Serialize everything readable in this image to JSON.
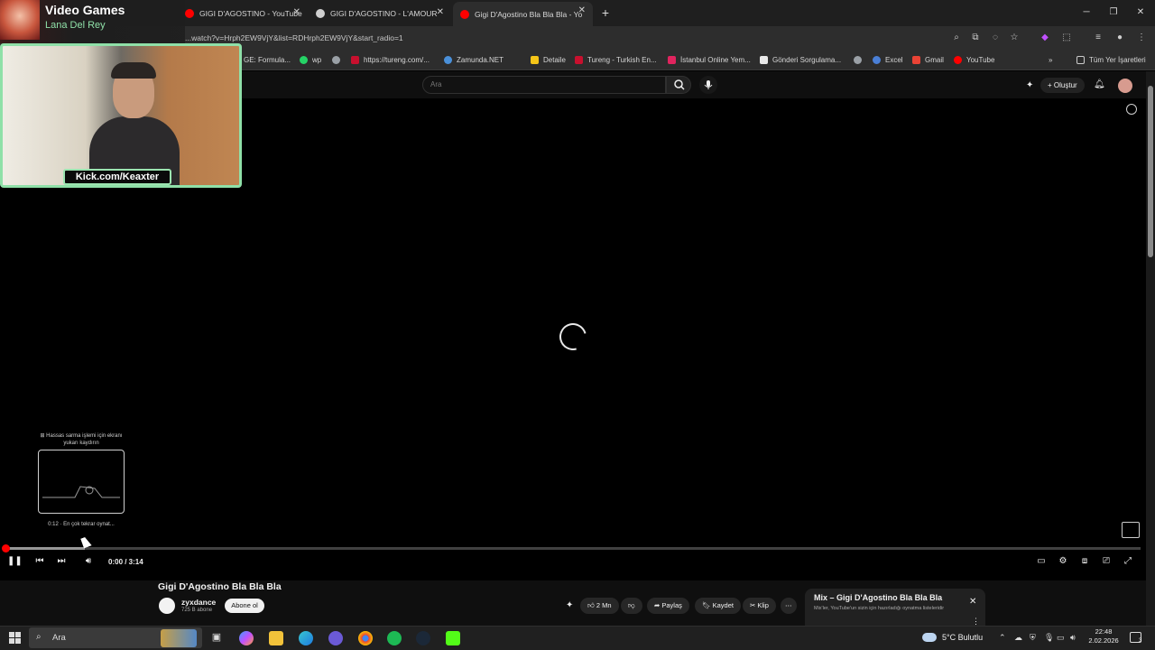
{
  "browser": {
    "tabs": [
      {
        "label": "GIGI D'AGOSTINO - YouTube",
        "color": "#ff0000"
      },
      {
        "label": "GIGI D'AGOSTINO - L'AMOUR",
        "color": "#cfcfcf"
      },
      {
        "label": "Gigi D'Agostino Bla Bla Bla - Yo",
        "color": "#ff0000"
      }
    ],
    "new_tab": "+",
    "url": "...watch?v=Hrph2EW9VjY&list=RDHrph2EW9VjY&start_radio=1",
    "bookmarks": [
      {
        "label": "GE: Formula...",
        "color": "#d93025"
      },
      {
        "label": "wp",
        "color": "#25d366"
      },
      {
        "label": "",
        "color": "#9aa0a6"
      },
      {
        "label": "https://tureng.com/...",
        "color": "#c8102e"
      },
      {
        "label": "Zamunda.NET",
        "color": "#4a90d9"
      },
      {
        "label": "Detaile",
        "color": "#f5c518"
      },
      {
        "label": "Tureng - Turkish En...",
        "color": "#c8102e"
      },
      {
        "label": "İstanbul Online Yem...",
        "color": "#e0245e"
      },
      {
        "label": "Gönderi Sorgulama...",
        "color": "#e8e8e8"
      },
      {
        "label": "",
        "color": "#9aa0a6"
      },
      {
        "label": "Excel",
        "color": "#217346"
      },
      {
        "label": "Gmail",
        "color": "#ea4335"
      },
      {
        "label": "YouTube",
        "color": "#ff0000"
      }
    ],
    "all_bookmarks": "Tüm Yer İşaretleri"
  },
  "overlay": {
    "song_title": "Video Games",
    "song_artist": "Lana Del Rey",
    "kick_label": "Kick.com/Keaxter"
  },
  "youtube": {
    "search_placeholder": "Ara",
    "create_label": "+ Oluştur",
    "player": {
      "preview_hint": "⊞ Hassas sarma işlemi için ekranı yukarı kaydırın",
      "preview_time": "0:12 · En çok tekrar oynat...",
      "time": "0:00 / 3:14",
      "progress_hover_fraction": 0.07
    },
    "video_title": "Gigi D'Agostino Bla Bla Bla",
    "channel": {
      "name": "zyxdance",
      "subs": "725 B abone",
      "subscribe": "Abone ol"
    },
    "actions": {
      "likes": "2 Mn",
      "share": "Paylaş",
      "save": "Kaydet",
      "clip": "Klip"
    },
    "mix": {
      "title": "Mix – Gigi D'Agostino Bla Bla Bla",
      "subtitle": "Mix'ler, YouTube'un sizin için hazırladığı oynatma listeleridir"
    }
  },
  "taskbar": {
    "search": "Ara",
    "weather": "5°C  Bulutlu",
    "time": "22:48",
    "date": "2.02.2026",
    "notif_count": "3"
  }
}
